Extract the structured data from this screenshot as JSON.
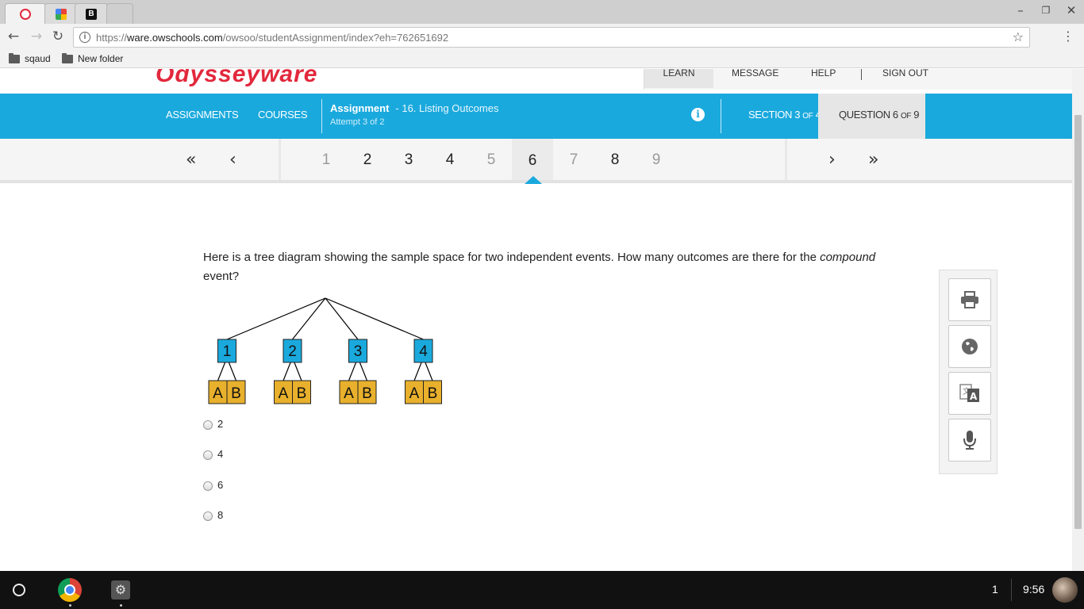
{
  "browser": {
    "address": {
      "scheme": "https://",
      "host": "ware.owschools.com",
      "path": "/owsoo/studentAssignment/index?eh=762651692"
    },
    "bookmarks": [
      "sqaud",
      "New folder"
    ]
  },
  "site_header": {
    "logo_fragment": "Odysseyware",
    "nav": [
      "LEARN",
      "MESSAGE",
      "HELP",
      "SIGN OUT"
    ]
  },
  "assignment_bar": {
    "assignments_link": "ASSIGNMENTS",
    "courses_link": "COURSES",
    "title_label": "Assignment",
    "title": "- 16. Listing Outcomes",
    "attempt": "Attempt 3 of 2",
    "section": {
      "word": "SECTION",
      "current": "3",
      "of": "OF",
      "total": "4"
    },
    "question": {
      "word": "QUESTION",
      "current": "6",
      "of": "OF",
      "total": "9"
    },
    "accent_color": "#1aa9dd"
  },
  "pager": {
    "pages": [
      "1",
      "2",
      "3",
      "4",
      "5",
      "6",
      "7",
      "8",
      "9"
    ],
    "current": "6"
  },
  "question": {
    "prompt_before": "Here is a tree diagram showing the sample space for two independent events. How many outcomes are there for the ",
    "prompt_emphasis": "compound",
    "prompt_after": " event?",
    "tree": {
      "first_level": [
        "1",
        "2",
        "3",
        "4"
      ],
      "second_level": [
        "A",
        "B"
      ],
      "first_color": "#1aa9dd",
      "second_color": "#e8b02c"
    },
    "choices": [
      "2",
      "4",
      "6",
      "8"
    ]
  },
  "tools": [
    "print-icon",
    "globe-icon",
    "translate-icon",
    "microphone-icon"
  ],
  "shelf": {
    "notification_count": "1",
    "time": "9:56"
  }
}
